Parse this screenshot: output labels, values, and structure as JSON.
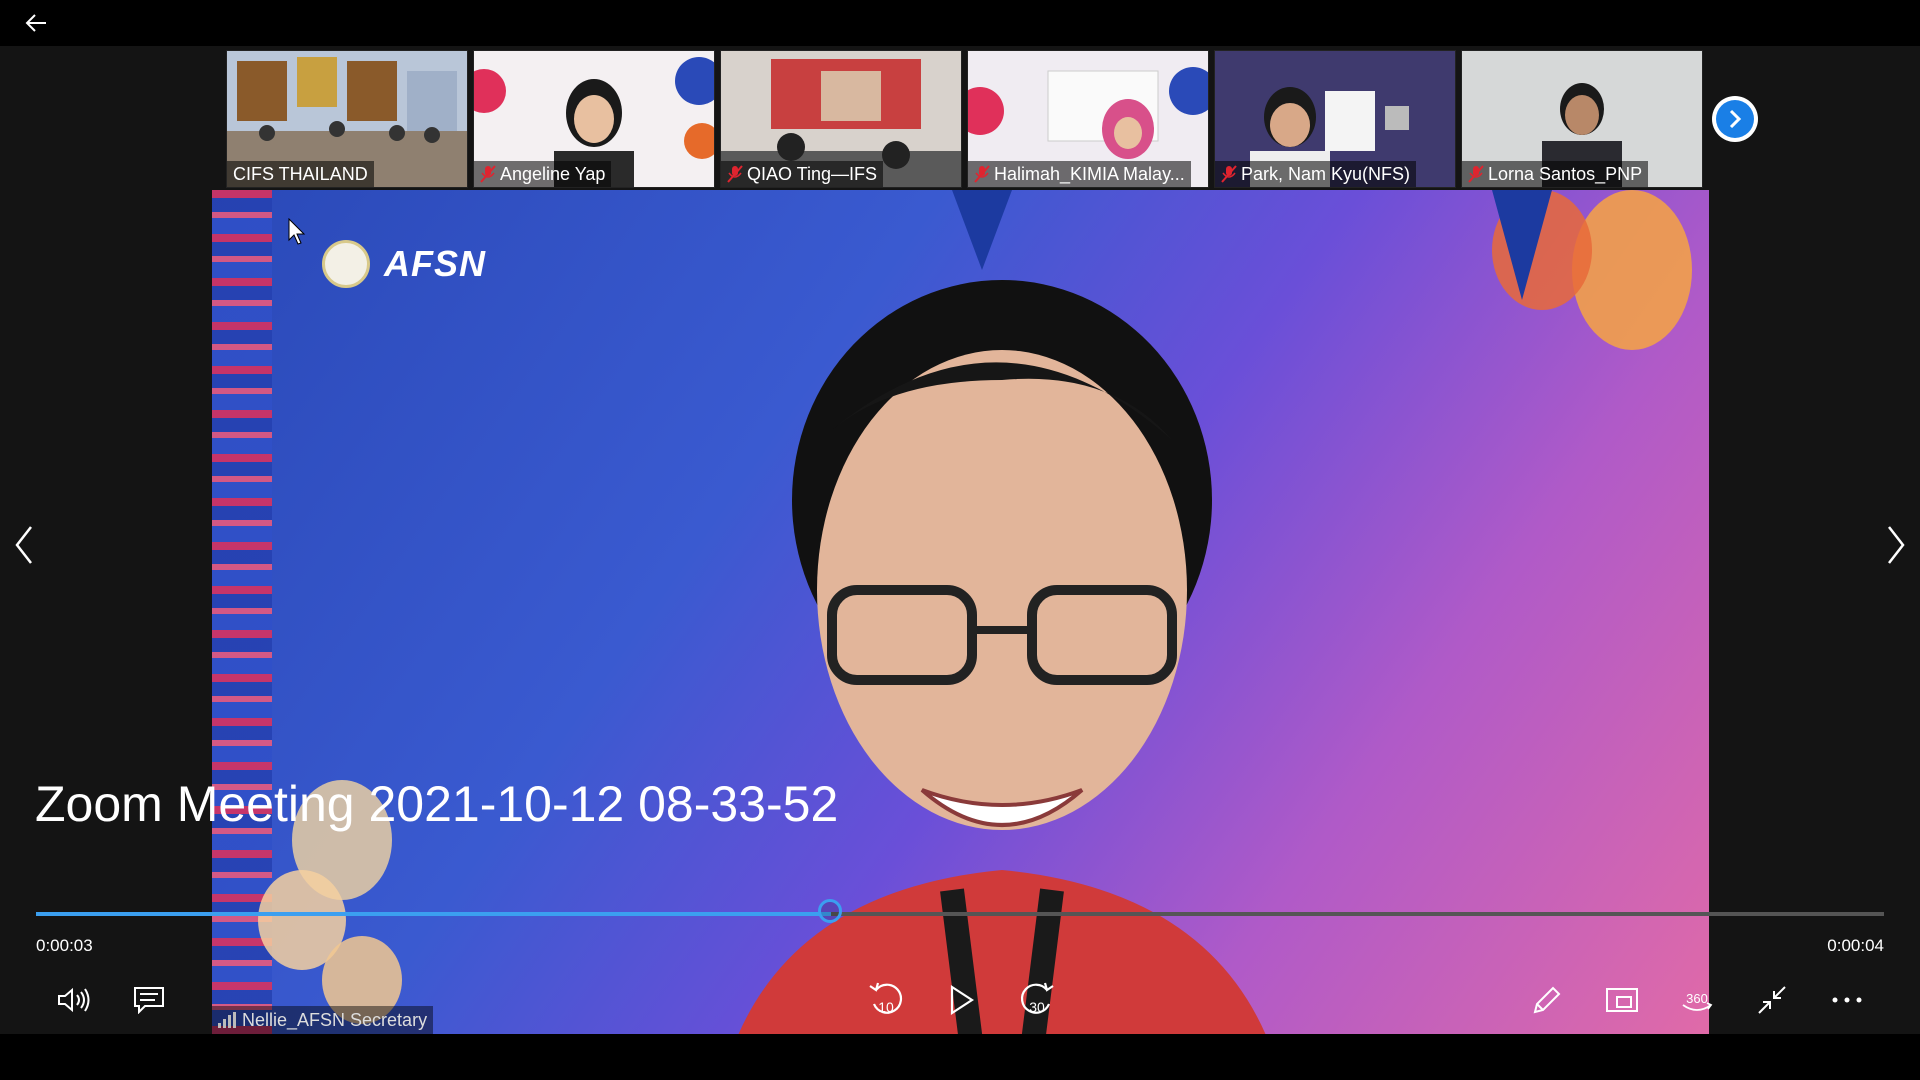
{
  "app": {
    "back_icon": "arrow-left-icon"
  },
  "participants": [
    {
      "name": "CIFS THAILAND",
      "muted": false,
      "bg": "#b9c6d8"
    },
    {
      "name": "Angeline Yap",
      "muted": true,
      "bg": "#e9e4ea"
    },
    {
      "name": "QIAO Ting—IFS",
      "muted": true,
      "bg": "#cfc8c2"
    },
    {
      "name": "Halimah_KIMIA Malay...",
      "muted": true,
      "bg": "#e8e2ea"
    },
    {
      "name": "Park, Nam Kyu(NFS)",
      "muted": true,
      "bg": "#3f3a6e"
    },
    {
      "name": "Lorna Santos_PNP",
      "muted": true,
      "bg": "#d6d8d8"
    }
  ],
  "main_video": {
    "logo_text": "AFSN",
    "speaker_name": "Nellie_AFSN Secretary"
  },
  "player": {
    "title": "Zoom Meeting 2021-10-12 08-33-52",
    "current_time": "0:00:03",
    "total_time": "0:00:04",
    "progress": 0.43,
    "skip_back_label": "10",
    "skip_forward_label": "30",
    "view_360_label": "360"
  },
  "colors": {
    "accent": "#3b9ff0",
    "next_button": "#1a7fe6",
    "mute_red": "#e0242f"
  }
}
